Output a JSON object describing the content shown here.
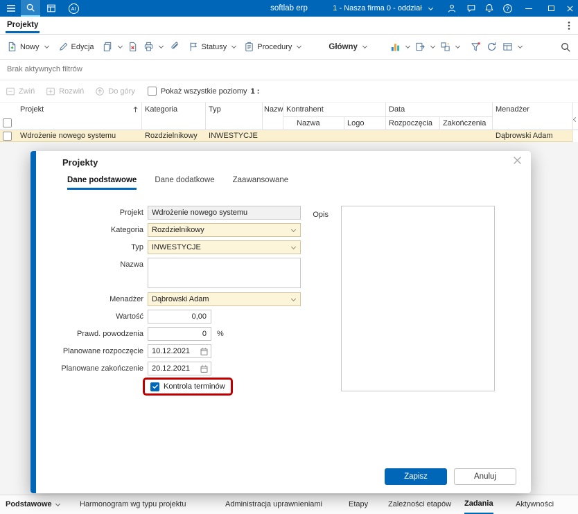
{
  "topbar": {
    "app_name": "softlab erp",
    "company": "1 - Nasza firma 0 - oddział",
    "ai": "AI"
  },
  "page_tabs": {
    "projekty": "Projekty"
  },
  "toolbar": {
    "nowy": "Nowy",
    "edycja": "Edycja",
    "statusy": "Statusy",
    "procedury": "Procedury",
    "glowny": "Główny"
  },
  "filter_bar": {
    "text": "Brak aktywnych filtrów"
  },
  "grid_toolbar": {
    "zwin": "Zwiń",
    "rozwin": "Rozwiń",
    "do_gory": "Do góry",
    "pokaz": "Pokaż wszystkie poziomy",
    "poziom": "1 :"
  },
  "grid": {
    "columns": {
      "projekt": "Projekt",
      "kategoria": "Kategoria",
      "typ": "Typ",
      "nazwa": "Nazwa",
      "kontrahent": "Kontrahent",
      "kontrahent_nazwa": "Nazwa",
      "kontrahent_logo": "Logo",
      "data": "Data",
      "rozpoczecia": "Rozpoczęcia",
      "zakonczenia": "Zakończenia",
      "menadzer": "Menadżer"
    },
    "row": {
      "projekt": "Wdrożenie nowego systemu",
      "kategoria": "Rozdzielnikowy",
      "typ": "INWESTYCJE",
      "menadzer": "Dąbrowski Adam"
    }
  },
  "modal": {
    "title": "Projekty",
    "tabs": {
      "podstawowe": "Dane podstawowe",
      "dodatkowe": "Dane dodatkowe",
      "zaawansowane": "Zaawansowane"
    },
    "fields": {
      "projekt_label": "Projekt",
      "projekt_value": "Wdrożenie nowego systemu",
      "kategoria_label": "Kategoria",
      "kategoria_value": "Rozdzielnikowy",
      "typ_label": "Typ",
      "typ_value": "INWESTYCJE",
      "nazwa_label": "Nazwa",
      "menadzer_label": "Menadżer",
      "menadzer_value": "Dąbrowski Adam",
      "wartosc_label": "Wartość",
      "wartosc_value": "0,00",
      "prawd_label": "Prawd. powodzenia",
      "prawd_value": "0",
      "prawd_suffix": "%",
      "rozp_label": "Planowane rozpoczęcie",
      "rozp_value": "10.12.2021",
      "zak_label": "Planowane zakończenie",
      "zak_value": "20.12.2021",
      "kontrola_label": "Kontrola terminów",
      "opis_label": "Opis"
    },
    "buttons": {
      "zapisz": "Zapisz",
      "anuluj": "Anuluj"
    }
  },
  "bottombar": {
    "podstawowe": "Podstawowe",
    "tabs": {
      "harmonogram": "Harmonogram wg typu projektu",
      "administracja": "Administracja uprawnieniami",
      "etapy": "Etapy",
      "zaleznosci": "Zależności etapów",
      "zadania": "Zadania",
      "aktywnosci": "Aktywności"
    }
  }
}
